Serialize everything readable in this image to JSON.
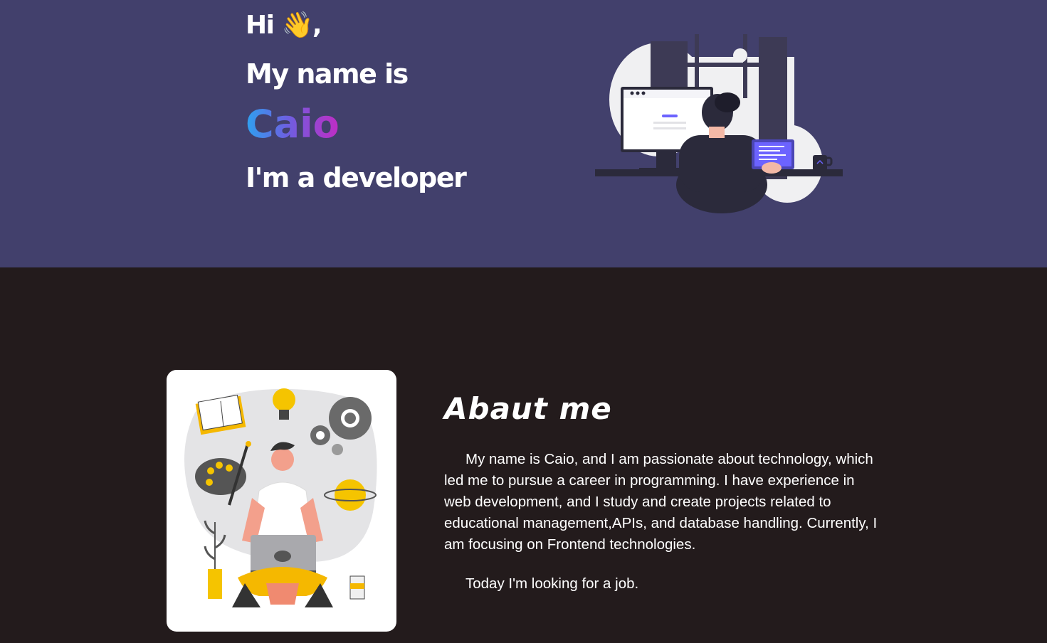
{
  "hero": {
    "greeting": "Hi 👋,",
    "name_intro": "My name is",
    "name": "Caio",
    "role": "I'm a developer",
    "illustration_icon": "developer-at-desk-illustration",
    "colors": {
      "background": "#42406c",
      "name_gradient": [
        "#2ea1f0",
        "#6d5fe0",
        "#c12cc4"
      ]
    }
  },
  "about": {
    "title": "Abaut  me",
    "paragraphs": [
      "My name is Caio, and I am passionate about technology, which led me to pursue a career in programming. I have experience in web development, and I study and create projects related to educational management,APIs, and database handling. Currently, I am focusing on Frontend technologies.",
      "Today I'm looking for a job."
    ],
    "illustration_icon": "creative-developer-illustration",
    "colors": {
      "background": "#231b1c",
      "card": "#ffffff"
    }
  }
}
